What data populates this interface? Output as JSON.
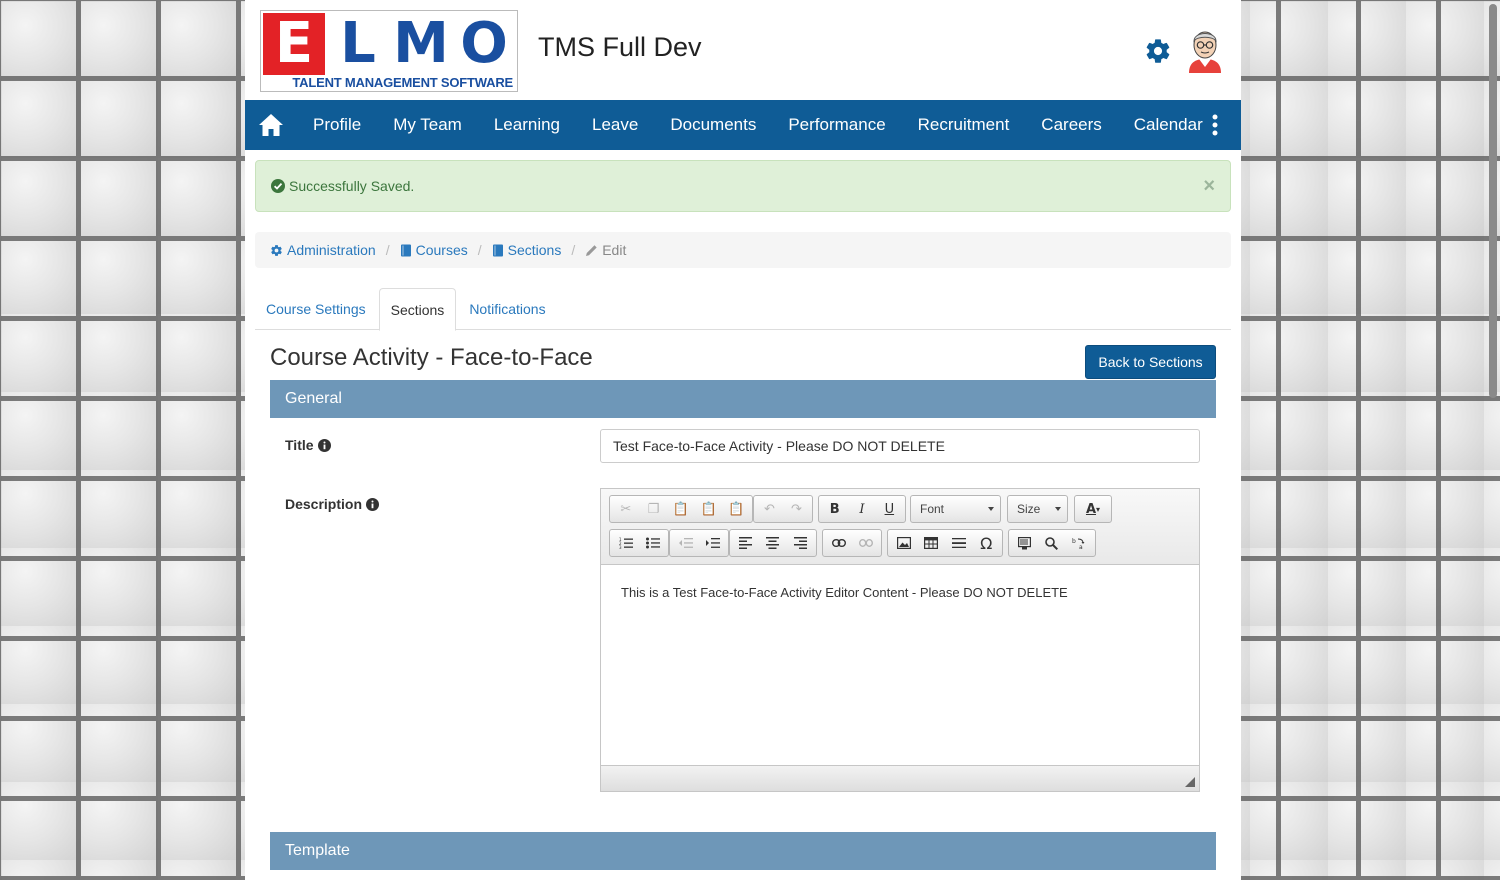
{
  "app": {
    "title": "TMS Full Dev"
  },
  "logo": {
    "letters": [
      "E",
      "L",
      "M",
      "O"
    ],
    "tagline": "TALENT MANAGEMENT SOFTWARE"
  },
  "nav": {
    "items": [
      "Profile",
      "My Team",
      "Learning",
      "Leave",
      "Documents",
      "Performance",
      "Recruitment",
      "Careers",
      "Calendar"
    ]
  },
  "alert": {
    "message": "Successfully Saved.",
    "close": "×"
  },
  "breadcrumb": {
    "administration": "Administration",
    "courses": "Courses",
    "sections": "Sections",
    "edit": "Edit",
    "separator": "/"
  },
  "tabs": {
    "course_settings": "Course Settings",
    "sections": "Sections",
    "notifications": "Notifications"
  },
  "page": {
    "heading": "Course Activity - Face-to-Face",
    "back_button": "Back to Sections"
  },
  "sections": {
    "general": "General",
    "template": "Template"
  },
  "form": {
    "title_label": "Title",
    "title_value": "Test Face-to-Face Activity - Please DO NOT DELETE",
    "description_label": "Description"
  },
  "editor": {
    "font_combo": "Font",
    "size_combo": "Size",
    "bold": "B",
    "italic": "I",
    "underline": "U",
    "text_color": "A",
    "special_char": "Ω",
    "content": "This is a Test Face-to-Face Activity Editor Content - Please DO NOT DELETE"
  },
  "colors": {
    "nav": "#0f5c96",
    "section_bar": "#6e97b8",
    "alert_bg": "#dff0d8",
    "link": "#2a79bd"
  }
}
